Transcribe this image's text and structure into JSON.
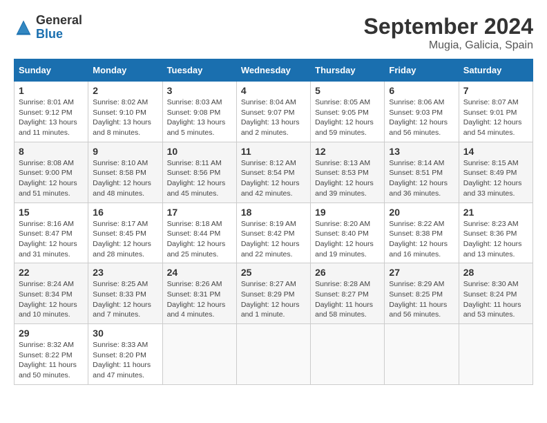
{
  "logo": {
    "line1": "General",
    "line2": "Blue"
  },
  "title": "September 2024",
  "location": "Mugia, Galicia, Spain",
  "headers": [
    "Sunday",
    "Monday",
    "Tuesday",
    "Wednesday",
    "Thursday",
    "Friday",
    "Saturday"
  ],
  "weeks": [
    [
      {
        "day": "1",
        "info": "Sunrise: 8:01 AM\nSunset: 9:12 PM\nDaylight: 13 hours and 11 minutes."
      },
      {
        "day": "2",
        "info": "Sunrise: 8:02 AM\nSunset: 9:10 PM\nDaylight: 13 hours and 8 minutes."
      },
      {
        "day": "3",
        "info": "Sunrise: 8:03 AM\nSunset: 9:08 PM\nDaylight: 13 hours and 5 minutes."
      },
      {
        "day": "4",
        "info": "Sunrise: 8:04 AM\nSunset: 9:07 PM\nDaylight: 13 hours and 2 minutes."
      },
      {
        "day": "5",
        "info": "Sunrise: 8:05 AM\nSunset: 9:05 PM\nDaylight: 12 hours and 59 minutes."
      },
      {
        "day": "6",
        "info": "Sunrise: 8:06 AM\nSunset: 9:03 PM\nDaylight: 12 hours and 56 minutes."
      },
      {
        "day": "7",
        "info": "Sunrise: 8:07 AM\nSunset: 9:01 PM\nDaylight: 12 hours and 54 minutes."
      }
    ],
    [
      {
        "day": "8",
        "info": "Sunrise: 8:08 AM\nSunset: 9:00 PM\nDaylight: 12 hours and 51 minutes."
      },
      {
        "day": "9",
        "info": "Sunrise: 8:10 AM\nSunset: 8:58 PM\nDaylight: 12 hours and 48 minutes."
      },
      {
        "day": "10",
        "info": "Sunrise: 8:11 AM\nSunset: 8:56 PM\nDaylight: 12 hours and 45 minutes."
      },
      {
        "day": "11",
        "info": "Sunrise: 8:12 AM\nSunset: 8:54 PM\nDaylight: 12 hours and 42 minutes."
      },
      {
        "day": "12",
        "info": "Sunrise: 8:13 AM\nSunset: 8:53 PM\nDaylight: 12 hours and 39 minutes."
      },
      {
        "day": "13",
        "info": "Sunrise: 8:14 AM\nSunset: 8:51 PM\nDaylight: 12 hours and 36 minutes."
      },
      {
        "day": "14",
        "info": "Sunrise: 8:15 AM\nSunset: 8:49 PM\nDaylight: 12 hours and 33 minutes."
      }
    ],
    [
      {
        "day": "15",
        "info": "Sunrise: 8:16 AM\nSunset: 8:47 PM\nDaylight: 12 hours and 31 minutes."
      },
      {
        "day": "16",
        "info": "Sunrise: 8:17 AM\nSunset: 8:45 PM\nDaylight: 12 hours and 28 minutes."
      },
      {
        "day": "17",
        "info": "Sunrise: 8:18 AM\nSunset: 8:44 PM\nDaylight: 12 hours and 25 minutes."
      },
      {
        "day": "18",
        "info": "Sunrise: 8:19 AM\nSunset: 8:42 PM\nDaylight: 12 hours and 22 minutes."
      },
      {
        "day": "19",
        "info": "Sunrise: 8:20 AM\nSunset: 8:40 PM\nDaylight: 12 hours and 19 minutes."
      },
      {
        "day": "20",
        "info": "Sunrise: 8:22 AM\nSunset: 8:38 PM\nDaylight: 12 hours and 16 minutes."
      },
      {
        "day": "21",
        "info": "Sunrise: 8:23 AM\nSunset: 8:36 PM\nDaylight: 12 hours and 13 minutes."
      }
    ],
    [
      {
        "day": "22",
        "info": "Sunrise: 8:24 AM\nSunset: 8:34 PM\nDaylight: 12 hours and 10 minutes."
      },
      {
        "day": "23",
        "info": "Sunrise: 8:25 AM\nSunset: 8:33 PM\nDaylight: 12 hours and 7 minutes."
      },
      {
        "day": "24",
        "info": "Sunrise: 8:26 AM\nSunset: 8:31 PM\nDaylight: 12 hours and 4 minutes."
      },
      {
        "day": "25",
        "info": "Sunrise: 8:27 AM\nSunset: 8:29 PM\nDaylight: 12 hours and 1 minute."
      },
      {
        "day": "26",
        "info": "Sunrise: 8:28 AM\nSunset: 8:27 PM\nDaylight: 11 hours and 58 minutes."
      },
      {
        "day": "27",
        "info": "Sunrise: 8:29 AM\nSunset: 8:25 PM\nDaylight: 11 hours and 56 minutes."
      },
      {
        "day": "28",
        "info": "Sunrise: 8:30 AM\nSunset: 8:24 PM\nDaylight: 11 hours and 53 minutes."
      }
    ],
    [
      {
        "day": "29",
        "info": "Sunrise: 8:32 AM\nSunset: 8:22 PM\nDaylight: 11 hours and 50 minutes."
      },
      {
        "day": "30",
        "info": "Sunrise: 8:33 AM\nSunset: 8:20 PM\nDaylight: 11 hours and 47 minutes."
      },
      {
        "day": "",
        "info": ""
      },
      {
        "day": "",
        "info": ""
      },
      {
        "day": "",
        "info": ""
      },
      {
        "day": "",
        "info": ""
      },
      {
        "day": "",
        "info": ""
      }
    ]
  ]
}
